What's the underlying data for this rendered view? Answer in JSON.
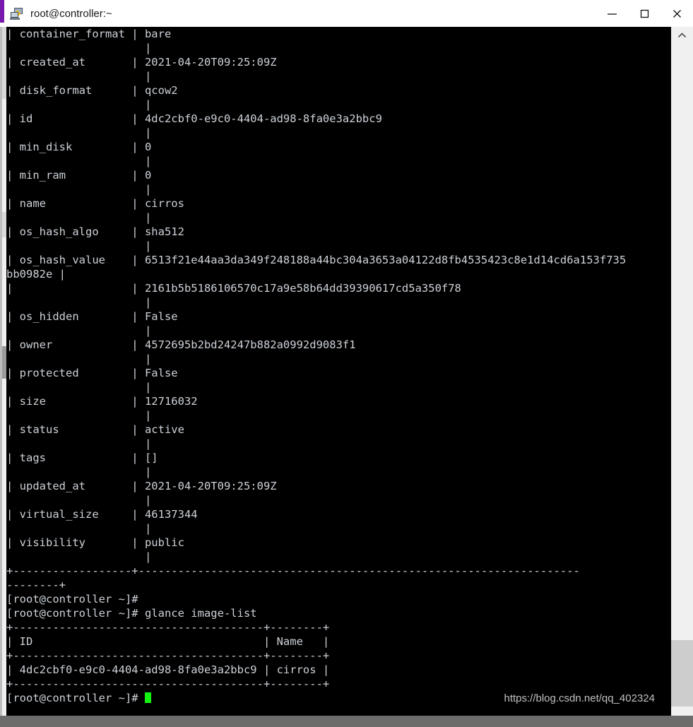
{
  "window": {
    "title": "root@controller:~",
    "icon": "remote-computer-icon",
    "accent_color": "#7719aa",
    "titlebar_bg": "#ffffff",
    "controls": {
      "minimize_label": "Minimize",
      "maximize_label": "Maximize",
      "close_label": "Close"
    }
  },
  "terminal": {
    "background_color": "#000000",
    "text_color": "#cdd2d8",
    "cursor_color": "#12f312",
    "prompt": "[root@controller ~]#",
    "command": "glance image-list",
    "lines": [
      "                     |",
      "| container_format | bare",
      "                     |",
      "| created_at       | 2021-04-20T09:25:09Z",
      "                     |",
      "| disk_format      | qcow2",
      "                     |",
      "| id               | 4dc2cbf0-e9c0-4404-ad98-8fa0e3a2bbc9",
      "                     |",
      "| min_disk         | 0",
      "                     |",
      "| min_ram          | 0",
      "                     |",
      "| name             | cirros",
      "                     |",
      "| os_hash_algo     | sha512",
      "                     |",
      "| os_hash_value    | 6513f21e44aa3da349f248188a44bc304a3653a04122d8fb4535423c8e1d14cd6a153f735",
      "bb0982e |",
      "|                  | 2161b5b5186106570c17a9e58b64dd39390617cd5a350f78",
      "                     |",
      "| os_hidden        | False",
      "                     |",
      "| owner            | 4572695b2bd24247b882a0992d9083f1",
      "                     |",
      "| protected        | False",
      "                     |",
      "| size             | 12716032",
      "                     |",
      "| status           | active",
      "                     |",
      "| tags             | []",
      "                     |",
      "| updated_at       | 2021-04-20T09:25:09Z",
      "                     |",
      "| virtual_size     | 46137344",
      "                     |",
      "| visibility       | public",
      "                     |",
      "+------------------+-------------------------------------------------------------------",
      "--------+",
      "[root@controller ~]#",
      "[root@controller ~]# glance image-list",
      "+--------------------------------------+--------+",
      "| ID                                   | Name   |",
      "+--------------------------------------+--------+",
      "| 4dc2cbf0-e9c0-4404-ad98-8fa0e3a2bbc9 | cirros |",
      "+--------------------------------------+--------+"
    ],
    "final_prompt": "[root@controller ~]# "
  },
  "image_details": {
    "container_format": "bare",
    "created_at": "2021-04-20T09:25:09Z",
    "disk_format": "qcow2",
    "id": "4dc2cbf0-e9c0-4404-ad98-8fa0e3a2bbc9",
    "min_disk": "0",
    "min_ram": "0",
    "name": "cirros",
    "os_hash_algo": "sha512",
    "os_hash_value": "6513f21e44aa3da349f248188a44bc304a3653a04122d8fb4535423c8e1d14cd6a153f735bb0982e2161b5b5186106570c17a9e58b64dd39390617cd5a350f78",
    "os_hidden": "False",
    "owner": "4572695b2bd24247b882a0992d9083f1",
    "protected": "False",
    "size": "12716032",
    "status": "active",
    "tags": "[]",
    "updated_at": "2021-04-20T09:25:09Z",
    "virtual_size": "46137344",
    "visibility": "public"
  },
  "image_list": {
    "columns": [
      "ID",
      "Name"
    ],
    "rows": [
      [
        "4dc2cbf0-e9c0-4404-ad98-8fa0e3a2bbc9",
        "cirros"
      ]
    ]
  },
  "watermark": {
    "url": "https://blog.csdn.net/qq_402324"
  },
  "scrollbar": {
    "up_arrow": "chevron-up-icon",
    "down_arrow": "chevron-down-icon"
  }
}
